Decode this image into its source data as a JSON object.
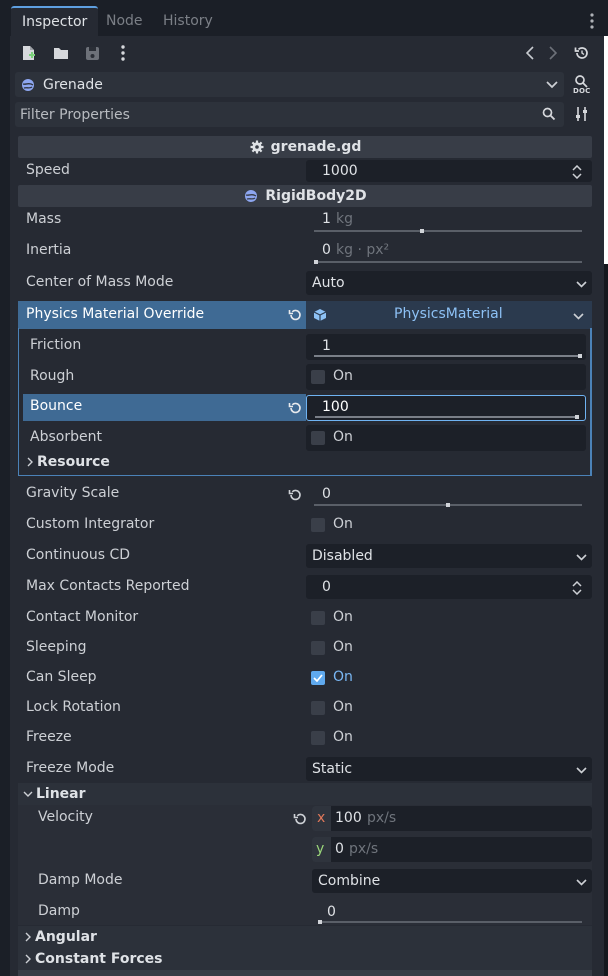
{
  "tabs": [
    {
      "label": "Inspector",
      "active": true
    },
    {
      "label": "Node",
      "active": false
    },
    {
      "label": "History",
      "active": false
    }
  ],
  "toolbar": {
    "icons": [
      "new-resource-icon",
      "open-folder-icon",
      "save-icon",
      "more-menu-icon",
      "back-icon",
      "forward-icon",
      "history-icon"
    ]
  },
  "object_selector": {
    "label": "Grenade",
    "doc_label": "DOC"
  },
  "filter": {
    "placeholder": "Filter Properties"
  },
  "script_section": {
    "title": "grenade.gd"
  },
  "speed": {
    "label": "Speed",
    "value": "1000"
  },
  "rigidbody_section": {
    "title": "RigidBody2D"
  },
  "mass": {
    "label": "Mass",
    "value": "1",
    "unit": "kg",
    "fill": 0.4
  },
  "inertia": {
    "label": "Inertia",
    "value": "0",
    "unit": "kg · px²",
    "fill": 0.0
  },
  "com_mode": {
    "label": "Center of Mass Mode",
    "value": "Auto"
  },
  "pmo": {
    "label": "Physics Material Override",
    "value": "PhysicsMaterial"
  },
  "friction": {
    "label": "Friction",
    "value": "1"
  },
  "rough": {
    "label": "Rough",
    "toggle": "On",
    "checked": false
  },
  "bounce": {
    "label": "Bounce",
    "value": "100"
  },
  "absorbent": {
    "label": "Absorbent",
    "toggle": "On",
    "checked": false
  },
  "resource_group": {
    "label": "Resource"
  },
  "gravity_scale": {
    "label": "Gravity Scale",
    "value": "0",
    "fill": 0.5
  },
  "custom_integrator": {
    "label": "Custom Integrator",
    "toggle": "On",
    "checked": false
  },
  "continuous_cd": {
    "label": "Continuous CD",
    "value": "Disabled"
  },
  "max_contacts": {
    "label": "Max Contacts Reported",
    "value": "0"
  },
  "contact_monitor": {
    "label": "Contact Monitor",
    "toggle": "On",
    "checked": false
  },
  "sleeping": {
    "label": "Sleeping",
    "toggle": "On",
    "checked": false
  },
  "can_sleep": {
    "label": "Can Sleep",
    "toggle": "On",
    "checked": true
  },
  "lock_rotation": {
    "label": "Lock Rotation",
    "toggle": "On",
    "checked": false
  },
  "freeze": {
    "label": "Freeze",
    "toggle": "On",
    "checked": false
  },
  "freeze_mode": {
    "label": "Freeze Mode",
    "value": "Static"
  },
  "linear_group": {
    "label": "Linear"
  },
  "velocity": {
    "label": "Velocity",
    "x_axis": "x",
    "x_value": "100",
    "y_axis": "y",
    "y_value": "0",
    "unit": "px/s"
  },
  "damp_mode": {
    "label": "Damp Mode",
    "value": "Combine"
  },
  "damp": {
    "label": "Damp",
    "value": "0"
  },
  "angular_group": {
    "label": "Angular"
  },
  "constant_forces_group": {
    "label": "Constant Forces"
  },
  "colors": {
    "accent": "#5fa9ee",
    "selection": "#3f6a94",
    "background": "#262a33"
  }
}
